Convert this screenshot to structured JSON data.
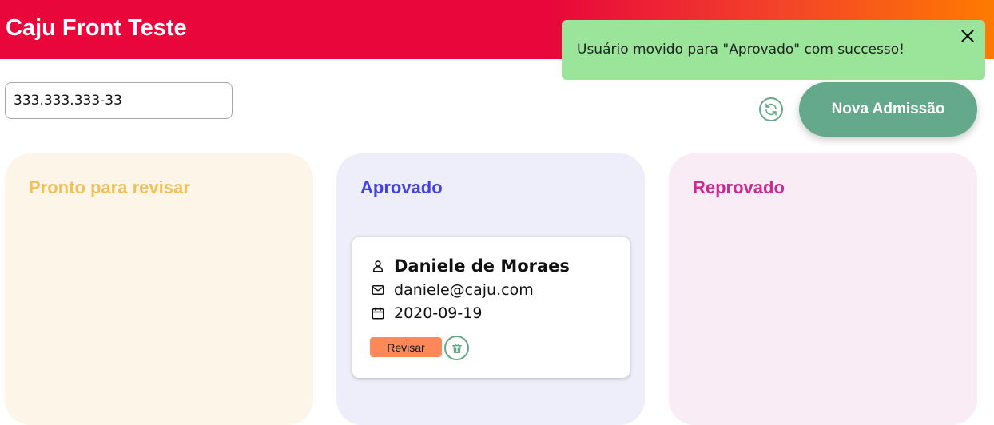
{
  "header": {
    "title": "Caju Front Teste"
  },
  "search": {
    "value": "333.333.333-33"
  },
  "toolbar": {
    "refresh_icon": "refresh-icon",
    "new_label": "Nova Admissão"
  },
  "toast": {
    "message": "Usuário movido para \"Aprovado\" com successo!",
    "close_icon": "close-icon"
  },
  "columns": [
    {
      "title": "Pronto para revisar",
      "color": "#f0c05a",
      "background": "#fdf6e8"
    },
    {
      "title": "Aprovado",
      "color": "#4242df",
      "background": "#eeedfa"
    },
    {
      "title": "Reprovado",
      "color": "#ce2893",
      "background": "#f9ecf5"
    }
  ],
  "card": {
    "name": "Daniele de Moraes",
    "email": "daniele@caju.com",
    "date": "2020-09-19",
    "revisar_label": "Revisar",
    "icons": [
      "user-icon",
      "mail-icon",
      "calendar-icon",
      "trash-icon"
    ]
  },
  "colors": {
    "brand": "#e8063b",
    "accent": "#64a98c",
    "toast": "#9be59b",
    "revisar": "#ff8858"
  }
}
